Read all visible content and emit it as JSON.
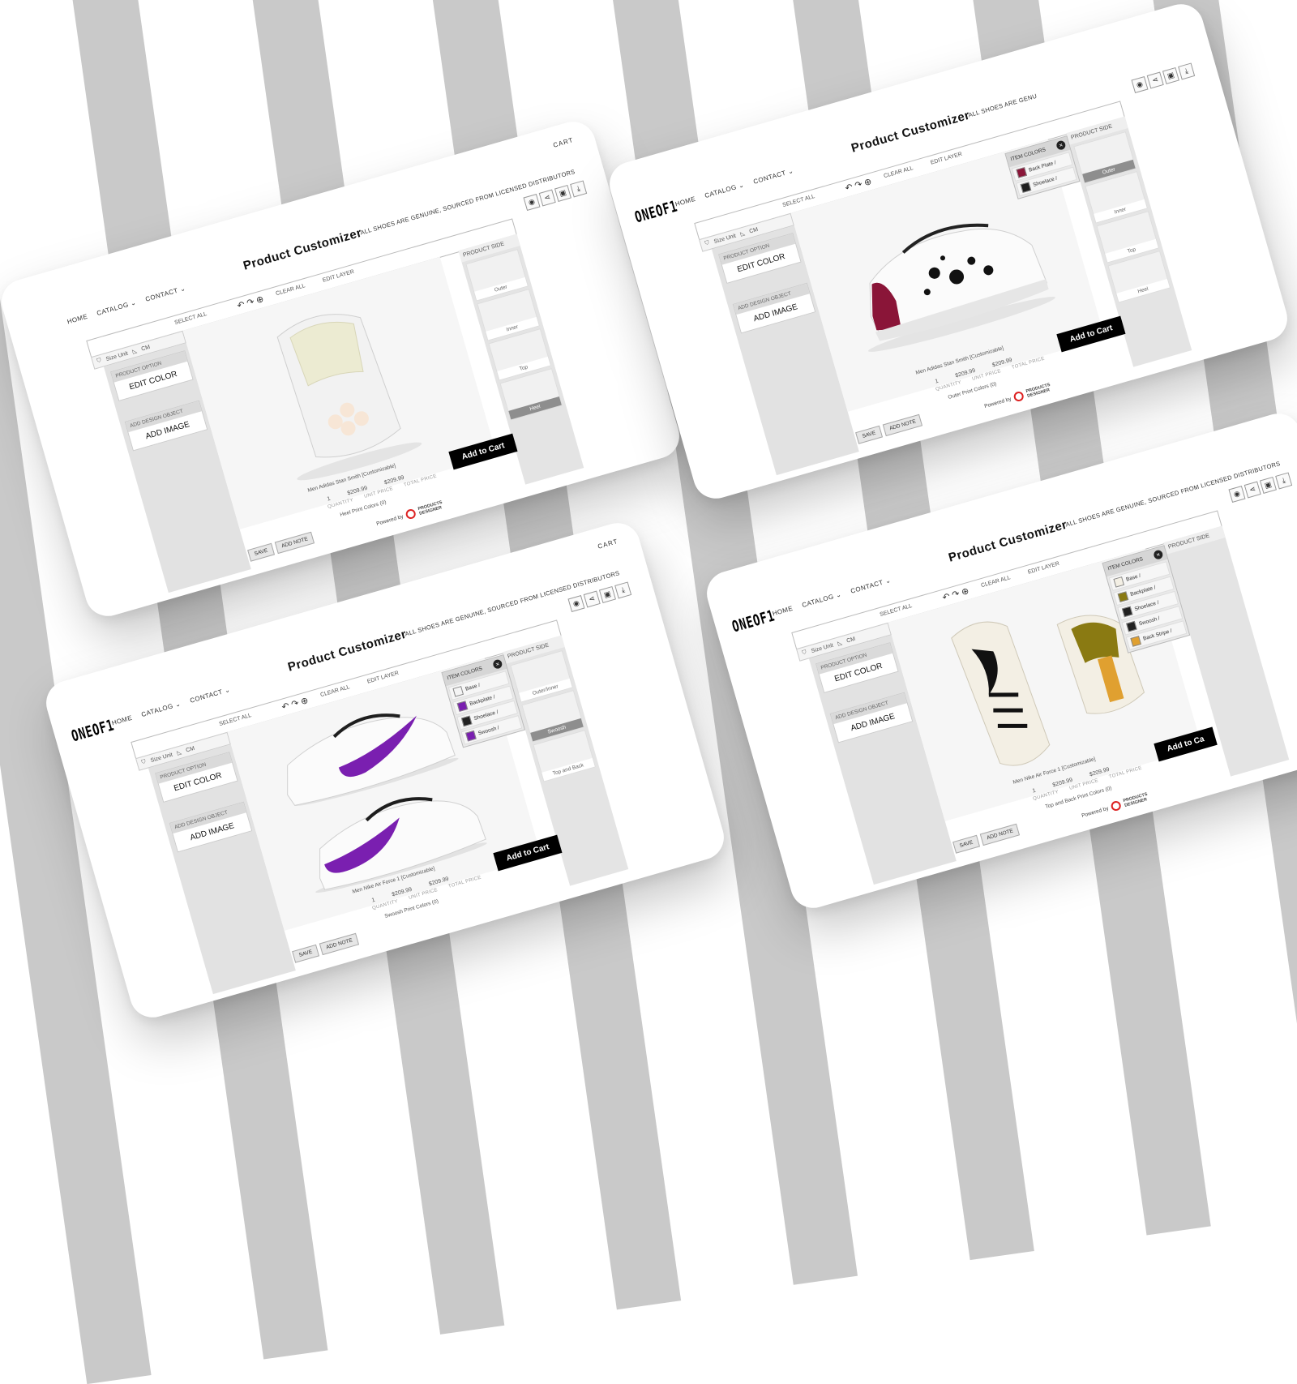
{
  "background": {
    "stripe_color": "#c9c9c9"
  },
  "screens": [
    {
      "id": "s1",
      "logo": "",
      "nav": [
        "HOME",
        "CATALOG ⌄",
        "CONTACT ⌄"
      ],
      "cart": "CART",
      "title": "Product Customizer",
      "tagline": "ALL SHOES ARE GENUINE, SOURCED FROM LICENSED DISTRIBUTORS",
      "toolbar": {
        "select_all": "SELECT ALL",
        "clear_all": "CLEAR ALL",
        "edit_layer": "EDIT LAYER"
      },
      "size_unit": {
        "label": "Size Unit",
        "value": "CM"
      },
      "product_option": {
        "header": "PRODUCT OPTION",
        "button": "EDIT COLOR"
      },
      "design_object": {
        "header": "ADD DESIGN OBJECT",
        "button": "ADD IMAGE"
      },
      "product_side": {
        "header": "PRODUCT SIDE",
        "items": [
          "Outer",
          "Inner",
          "Top",
          "Heel"
        ],
        "selected": 3
      },
      "item_colors": null,
      "product_name": "Men Adidas Stan Smith [Customizable]",
      "quantity": "1",
      "unit_price": "$209.99",
      "total_price": "$209.99",
      "labels": {
        "quantity": "QUANTITY",
        "unit": "UNIT PRICE",
        "total": "TOTAL PRICE"
      },
      "print_colors": "Heel Print Colors  (0)",
      "add_to_cart": "Add to Cart",
      "save": "SAVE",
      "add_note": "ADD NOTE",
      "powered": "Powered by",
      "pd_line1": "PRODUCTS",
      "pd_line2": "DESIGNER",
      "shoe": "adidas-heel"
    },
    {
      "id": "s2",
      "logo": "ONEOF1",
      "nav": [
        "HOME",
        "CATALOG ⌄",
        "CONTACT ⌄"
      ],
      "cart": "",
      "title": "Product Customizer",
      "tagline": "ALL SHOES ARE GENU",
      "toolbar": {
        "select_all": "SELECT ALL",
        "clear_all": "CLEAR ALL",
        "edit_layer": "EDIT LAYER"
      },
      "size_unit": {
        "label": "Size Unit",
        "value": "CM"
      },
      "product_option": {
        "header": "PRODUCT OPTION",
        "button": "EDIT COLOR"
      },
      "design_object": {
        "header": "ADD DESIGN OBJECT",
        "button": "ADD IMAGE"
      },
      "product_side": {
        "header": "PRODUCT SIDE",
        "items": [
          "Outer",
          "Inner",
          "Top",
          "Heel"
        ],
        "selected": 0
      },
      "item_colors": {
        "header": "ITEM COLORS",
        "rows": [
          {
            "name": "Back Plate",
            "color": "#8a1538"
          },
          {
            "name": "Shoelace",
            "color": "#1e1e1e"
          }
        ]
      },
      "product_name": "Men Adidas Stan Smith [Customizable]",
      "quantity": "1",
      "unit_price": "$209.99",
      "total_price": "$209.99",
      "labels": {
        "quantity": "QUANTITY",
        "unit": "UNIT PRICE",
        "total": "TOTAL PRICE"
      },
      "print_colors": "Outer Print Colors  (0)",
      "add_to_cart": "Add to Cart",
      "save": "SAVE",
      "add_note": "ADD NOTE",
      "powered": "Powered by",
      "pd_line1": "PRODUCTS",
      "pd_line2": "DESIGNER",
      "shoe": "adidas-splatter"
    },
    {
      "id": "s3",
      "logo": "ONEOF1",
      "nav": [
        "HOME",
        "CATALOG ⌄",
        "CONTACT ⌄"
      ],
      "cart": "CART",
      "title": "Product Customizer",
      "tagline": "ALL SHOES ARE GENUINE, SOURCED FROM LICENSED DISTRIBUTORS",
      "toolbar": {
        "select_all": "SELECT ALL",
        "clear_all": "CLEAR ALL",
        "edit_layer": "EDIT LAYER"
      },
      "size_unit": {
        "label": "Size Unit",
        "value": "CM"
      },
      "product_option": {
        "header": "PRODUCT OPTION",
        "button": "EDIT COLOR"
      },
      "design_object": {
        "header": "ADD DESIGN OBJECT",
        "button": "ADD IMAGE"
      },
      "product_side": {
        "header": "PRODUCT SIDE",
        "items": [
          "Outer/Inner",
          "Swoosh",
          "Top and Back"
        ],
        "selected": 1
      },
      "item_colors": {
        "header": "ITEM COLORS",
        "rows": [
          {
            "name": "Base",
            "color": "#f4f4f4"
          },
          {
            "name": "Backplate",
            "color": "#7a1fb0"
          },
          {
            "name": "Shoelace",
            "color": "#222222"
          },
          {
            "name": "Swoosh",
            "color": "#7a1fb0"
          }
        ]
      },
      "product_name": "Men Nike Air Force 1 [Customizable]",
      "quantity": "1",
      "unit_price": "$209.99",
      "total_price": "$209.99",
      "labels": {
        "quantity": "QUANTITY",
        "unit": "UNIT PRICE",
        "total": "TOTAL PRICE"
      },
      "print_colors": "Swoosh Print Colors  (0)",
      "add_to_cart": "Add to Cart",
      "save": "SAVE",
      "add_note": "ADD NOTE",
      "powered": "",
      "pd_line1": "",
      "pd_line2": "",
      "shoe": "nike-purple"
    },
    {
      "id": "s4",
      "logo": "ONEOF1",
      "nav": [
        "HOME",
        "CATALOG ⌄",
        "CONTACT ⌄"
      ],
      "cart": "",
      "title": "Product Customizer",
      "tagline": "ALL SHOES ARE GENUINE, SOURCED FROM LICENSED DISTRIBUTORS",
      "toolbar": {
        "select_all": "SELECT ALL",
        "clear_all": "CLEAR ALL",
        "edit_layer": "EDIT LAYER"
      },
      "size_unit": {
        "label": "Size Unit",
        "value": "CM"
      },
      "product_option": {
        "header": "PRODUCT OPTION",
        "button": "EDIT COLOR"
      },
      "design_object": {
        "header": "ADD DESIGN OBJECT",
        "button": "ADD IMAGE"
      },
      "product_side": {
        "header": "PRODUCT SIDE",
        "items": [],
        "selected": -1
      },
      "item_colors": {
        "header": "ITEM COLORS",
        "rows": [
          {
            "name": "Base",
            "color": "#f3efe4"
          },
          {
            "name": "Backplate",
            "color": "#8a7a12"
          },
          {
            "name": "Shoelace",
            "color": "#222222"
          },
          {
            "name": "Swoosh",
            "color": "#222222"
          },
          {
            "name": "Back Stripe",
            "color": "#e0a030"
          }
        ]
      },
      "product_name": "Men Nike Air Force 1 [Customizable]",
      "quantity": "1",
      "unit_price": "$209.99",
      "total_price": "$209.99",
      "labels": {
        "quantity": "QUANTITY",
        "unit": "UNIT PRICE",
        "total": "TOTAL PRICE"
      },
      "print_colors": "Top and Back Print Colors  (0)",
      "add_to_cart": "Add to Ca",
      "save": "SAVE",
      "add_note": "ADD NOTE",
      "powered": "Powered by",
      "pd_line1": "PRODUCTS",
      "pd_line2": "DESIGNER",
      "shoe": "nike-flame"
    }
  ]
}
